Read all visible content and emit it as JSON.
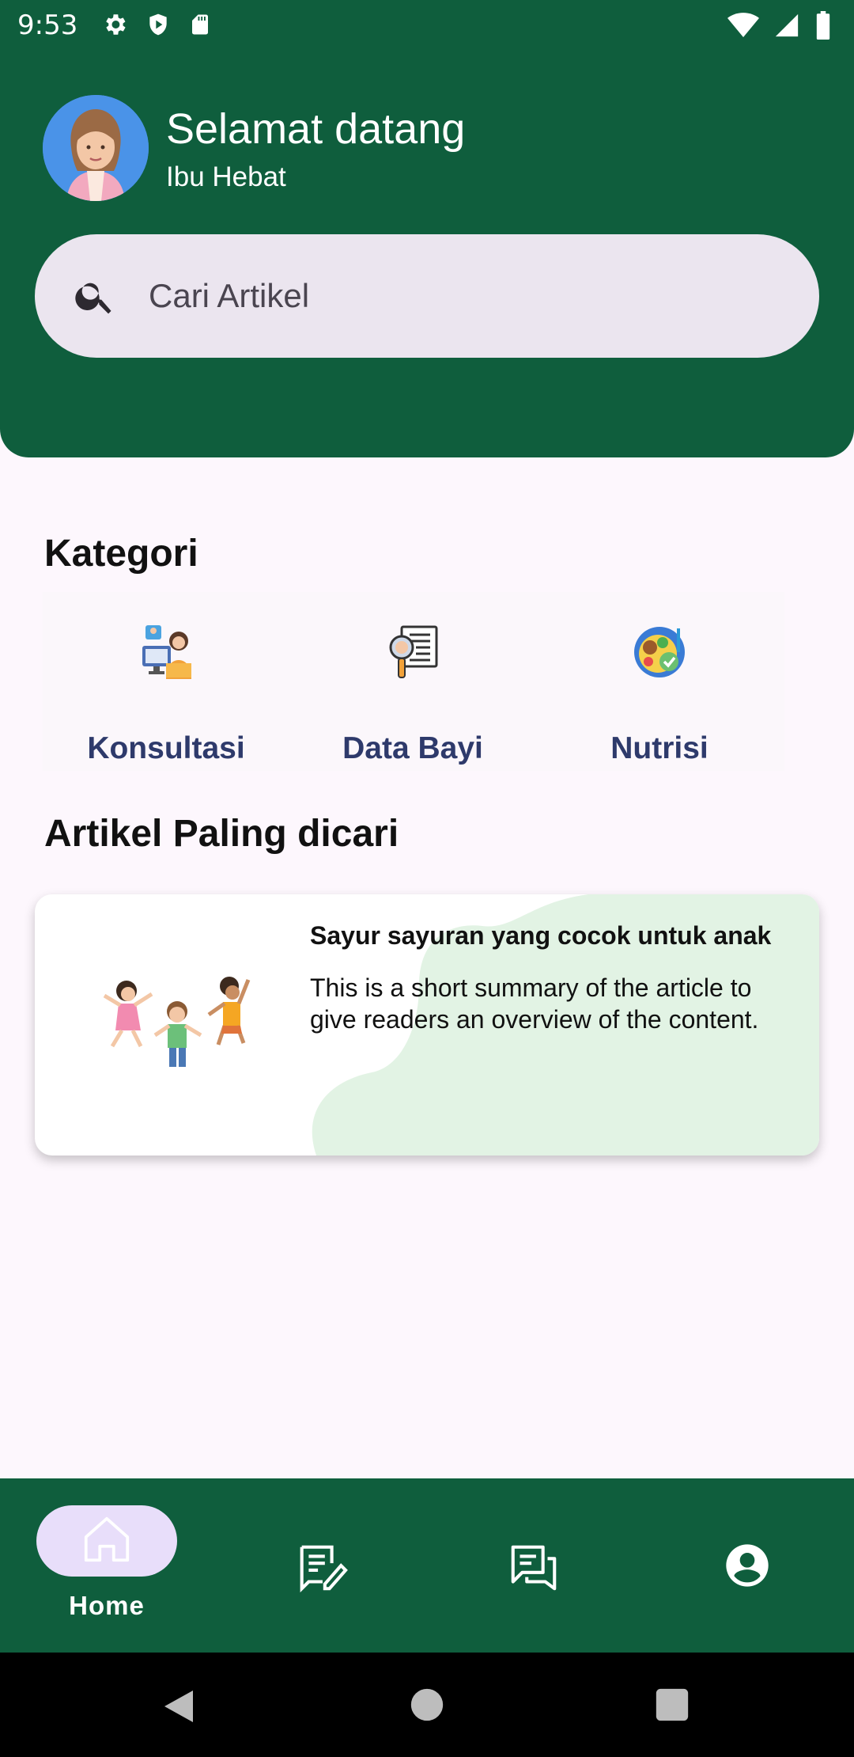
{
  "status_bar": {
    "time": "9:53",
    "left_icons": [
      "gear-icon",
      "shield-play-icon",
      "sd-card-icon"
    ],
    "right_icons": [
      "wifi-icon",
      "signal-icon",
      "battery-icon"
    ]
  },
  "header": {
    "greeting": "Selamat datang",
    "username": "Ibu Hebat",
    "avatar_icon": "user-avatar-icon",
    "background_color": "#0f5e3d"
  },
  "search": {
    "placeholder": "Cari Artikel",
    "icon": "search-icon"
  },
  "categories": {
    "title": "Kategori",
    "items": [
      {
        "label": "Konsultasi",
        "icon": "consultation-icon"
      },
      {
        "label": "Data Bayi",
        "icon": "baby-data-icon"
      },
      {
        "label": "Nutrisi",
        "icon": "nutrition-icon"
      }
    ]
  },
  "articles": {
    "title": "Artikel Paling dicari",
    "items": [
      {
        "title": "Sayur sayuran yang cocok untuk anak",
        "summary": "This is a short summary of the article to give readers an overview of the content.",
        "image_icon": "kids-playing-illustration"
      }
    ]
  },
  "bottom_nav": {
    "items": [
      {
        "label": "Home",
        "icon": "home-icon",
        "active": true
      },
      {
        "label": "",
        "icon": "edit-note-icon",
        "active": false
      },
      {
        "label": "",
        "icon": "chat-icon",
        "active": false
      },
      {
        "label": "",
        "icon": "account-icon",
        "active": false
      }
    ]
  },
  "system_nav": [
    "back-icon",
    "home-circle-icon",
    "recents-icon"
  ],
  "colors": {
    "primary": "#0f5e3d",
    "background": "#fdf7fd",
    "category_label": "#2e3a6b",
    "active_pill": "#e8defa",
    "card_blob": "#e2f3e4"
  }
}
